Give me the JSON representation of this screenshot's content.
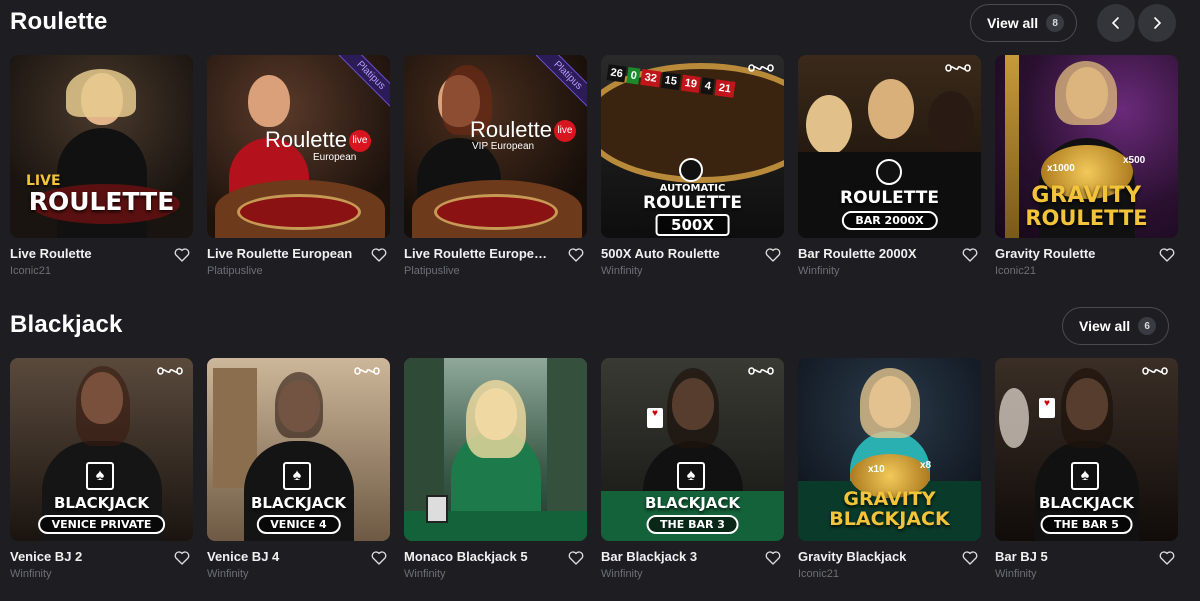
{
  "roulette": {
    "title": "Roulette",
    "view_all_label": "View all",
    "view_all_count": "8",
    "prev_icon": "chevron-left-icon",
    "next_icon": "chevron-right-icon",
    "cards": [
      {
        "name": "Live Roulette",
        "provider": "Iconic21",
        "art_line1": "LIVE",
        "art_line2": "ROULETTE"
      },
      {
        "name": "Live Roulette European",
        "provider": "Platipuslive",
        "art_line1": "Roulette",
        "art_line2": "European",
        "badge": "live",
        "ribbon": "Platipus"
      },
      {
        "name": "Live Roulette European ...",
        "provider": "Platipuslive",
        "art_line1": "Roulette",
        "art_line2": "VIP European",
        "badge": "live",
        "ribbon": "Platipus"
      },
      {
        "name": "500X Auto Roulette",
        "provider": "Winfinity",
        "art_line1": "AUTOMATIC",
        "art_line2": "ROULETTE",
        "art_line3": "500X",
        "wheel_numbers": [
          "26",
          "0",
          "32",
          "15",
          "19",
          "4",
          "21"
        ]
      },
      {
        "name": "Bar Roulette 2000X",
        "provider": "Winfinity",
        "art_line1": "ROULETTE",
        "art_line2": "BAR 2000X"
      },
      {
        "name": "Gravity Roulette",
        "provider": "Iconic21",
        "art_line1": "GRAVITY",
        "art_line2": "ROULETTE",
        "mult1": "x1000",
        "mult2": "x500"
      }
    ]
  },
  "blackjack": {
    "title": "Blackjack",
    "view_all_label": "View all",
    "view_all_count": "6",
    "cards": [
      {
        "name": "Venice BJ 2",
        "provider": "Winfinity",
        "art_line1": "BLACKJACK",
        "art_line2": "VENICE PRIVATE"
      },
      {
        "name": "Venice BJ 4",
        "provider": "Winfinity",
        "art_line1": "BLACKJACK",
        "art_line2": "VENICE 4"
      },
      {
        "name": "Monaco Blackjack 5",
        "provider": "Winfinity"
      },
      {
        "name": "Bar Blackjack 3",
        "provider": "Winfinity",
        "art_line1": "BLACKJACK",
        "art_line2": "THE BAR 3"
      },
      {
        "name": "Gravity Blackjack",
        "provider": "Iconic21",
        "art_line1": "GRAVITY",
        "art_line2": "BLACKJACK",
        "mult1": "x10",
        "mult2": "x8"
      },
      {
        "name": "Bar BJ 5",
        "provider": "Winfinity",
        "art_line1": "BLACKJACK",
        "art_line2": "THE BAR 5"
      }
    ]
  },
  "icons": {
    "favorite": "heart-outline-icon",
    "provider_logo": "infinity-icon"
  },
  "colors": {
    "background": "#1d1d22",
    "provider_text": "#6e6e78",
    "live_red": "#d8151f",
    "gold": "#f3c43a"
  }
}
